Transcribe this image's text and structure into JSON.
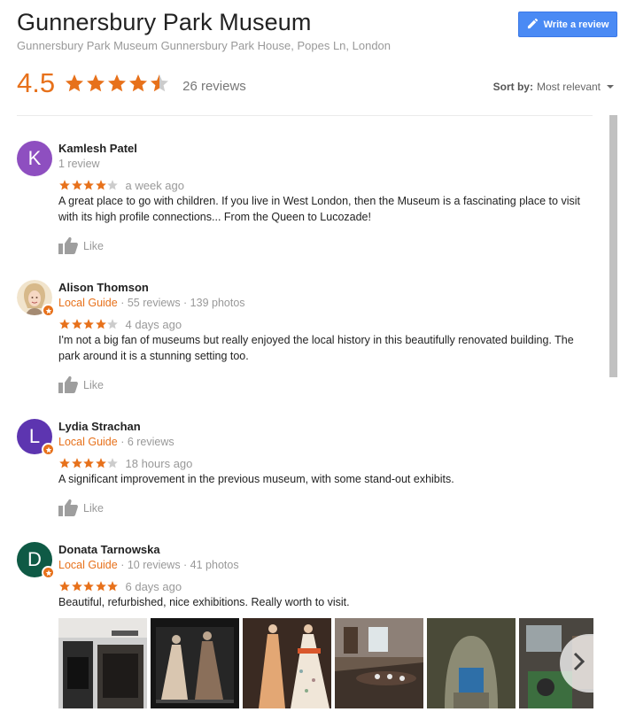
{
  "header": {
    "title": "Gunnersbury Park Museum",
    "address": "Gunnersbury Park Museum Gunnersbury Park House, Popes Ln, London",
    "write_review_label": "Write a review",
    "rating": "4.5",
    "rating_value": 4.5,
    "review_count": "26 reviews",
    "sort_label": "Sort by:",
    "sort_value": "Most relevant"
  },
  "colors": {
    "star": "#e7711b",
    "star_empty": "#cccccc",
    "button": "#4a8af4"
  },
  "reviews": [
    {
      "name": "Kamlesh Patel",
      "initial": "K",
      "avatar_color": "#8e4fc0",
      "local_guide": "",
      "meta": "1 review",
      "stars": 4,
      "date": "a week ago",
      "text": "A great place to go with children. If you live in West London, then the Museum is a fascinating place to visit with its high profile connections... From the Queen to Lucozade!",
      "like_label": "Like"
    },
    {
      "name": "Alison Thomson",
      "initial": "",
      "avatar_color": "#d9c7a8",
      "local_guide": "Local Guide",
      "meta": " · 55 reviews · 139 photos",
      "stars": 4,
      "date": "4 days ago",
      "text": "I'm not a big fan of museums but really enjoyed the local history in this beautifully renovated building. The park around it is a stunning setting too.",
      "like_label": "Like"
    },
    {
      "name": "Lydia Strachan",
      "initial": "L",
      "avatar_color": "#5d35b0",
      "local_guide": "Local Guide",
      "meta": " · 6 reviews",
      "stars": 4,
      "date": "18 hours ago",
      "text": "A significant improvement in the previous museum, with some stand-out exhibits.",
      "like_label": "Like"
    },
    {
      "name": "Donata Tarnowska",
      "initial": "D",
      "avatar_color": "#0f5a45",
      "local_guide": "Local Guide",
      "meta": " · 10 reviews · 41 photos",
      "stars": 5,
      "date": "6 days ago",
      "text": "Beautiful, refurbished, nice exhibitions. Really worth to visit.",
      "like_label": "Like"
    }
  ],
  "photos": [
    {
      "name": "photo-fireplace-room"
    },
    {
      "name": "photo-dress-display"
    },
    {
      "name": "photo-mannequin-dresses"
    },
    {
      "name": "photo-dining-room"
    },
    {
      "name": "photo-grotto"
    },
    {
      "name": "photo-exhibit-room"
    }
  ]
}
